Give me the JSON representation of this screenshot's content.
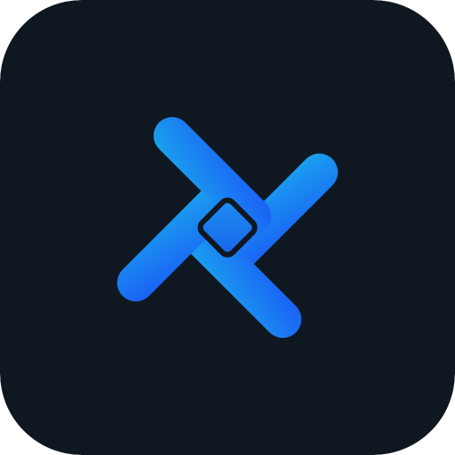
{
  "app_icon": {
    "logo": "rotated-diamond-window-logo",
    "colors": {
      "background": "#0f1720",
      "gradient_light": "#1aa3ee",
      "gradient_dark": "#1a5ef5",
      "center_light": "#1d8ff0",
      "center_dark": "#1764ec"
    }
  }
}
